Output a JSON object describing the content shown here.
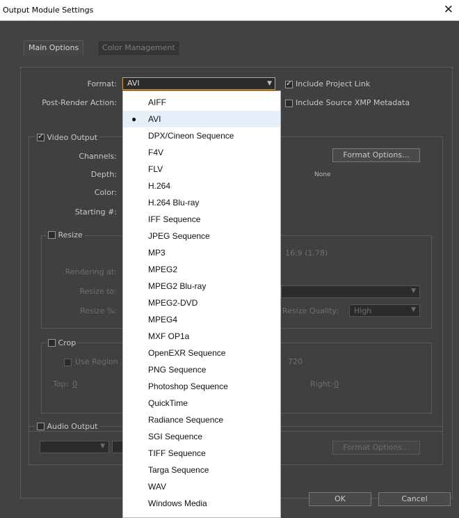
{
  "window": {
    "title": "Output Module Settings",
    "close_glyph": "✕"
  },
  "tabs": [
    {
      "label": "Main Options"
    },
    {
      "label": "Color Management"
    }
  ],
  "format": {
    "label": "Format:",
    "value": "AVI",
    "arrow": "▼"
  },
  "post_render": {
    "label": "Post-Render Action:"
  },
  "include_project_link": {
    "label": "Include Project Link",
    "checked": true
  },
  "include_xmp": {
    "label": "Include Source XMP Metadata",
    "checked": false
  },
  "video_output": {
    "label": "Video Output",
    "checked": true,
    "channels_label": "Channels:",
    "depth_label": "Depth:",
    "color_label": "Color:",
    "starting_label": "Starting #:",
    "format_options_label": "Format Options...",
    "codec_value": "None"
  },
  "resize": {
    "label": "Resize",
    "checked": false,
    "rendering_at_label": "Rendering at:",
    "resize_to_label": "Resize to:",
    "resize_pct_label": "Resize %:",
    "aspect_text": "16:9 (1.78)",
    "quality_label": "Resize Quality:",
    "quality_value": "High",
    "arrow": "▼"
  },
  "crop": {
    "label": "Crop",
    "checked": false,
    "use_region_label": "Use Region",
    "top_label": "Top:",
    "top_value": "0",
    "right_label": "Right:",
    "right_value": "0",
    "size_text": "720"
  },
  "audio_output": {
    "label": "Audio Output",
    "checked": false,
    "format_options_label": "Format Options...",
    "arrow": "▼"
  },
  "buttons": {
    "ok": "OK",
    "cancel": "Cancel"
  },
  "dropdown": {
    "selected": "AVI",
    "bullet": "●",
    "items": [
      "AIFF",
      "AVI",
      "DPX/Cineon Sequence",
      "F4V",
      "FLV",
      "H.264",
      "H.264 Blu-ray",
      "IFF Sequence",
      "JPEG Sequence",
      "MP3",
      "MPEG2",
      "MPEG2 Blu-ray",
      "MPEG2-DVD",
      "MPEG4",
      "MXF OP1a",
      "OpenEXR Sequence",
      "PNG Sequence",
      "Photoshop Sequence",
      "QuickTime",
      "Radiance Sequence",
      "SGI Sequence",
      "TIFF Sequence",
      "Targa Sequence",
      "WAV",
      "Windows Media"
    ]
  }
}
